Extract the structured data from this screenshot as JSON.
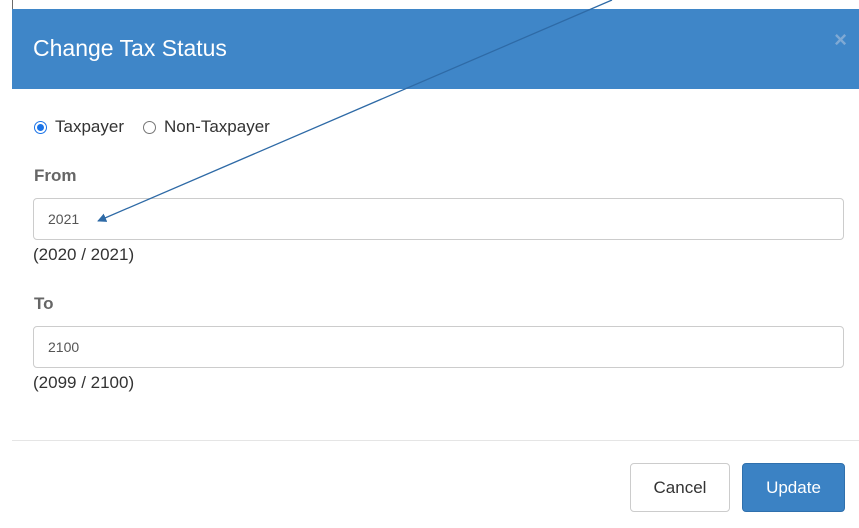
{
  "dialog": {
    "title": "Change Tax Status",
    "close_symbol": "×"
  },
  "tax_status": {
    "options": [
      {
        "label": "Taxpayer",
        "checked": true
      },
      {
        "label": "Non-Taxpayer",
        "checked": false
      }
    ]
  },
  "from": {
    "label": "From",
    "value": "2021",
    "hint": "(2020 / 2021)"
  },
  "to": {
    "label": "To",
    "value": "2100",
    "hint": "(2099 / 2100)"
  },
  "footer": {
    "cancel_label": "Cancel",
    "update_label": "Update"
  },
  "colors": {
    "header": "#3f86c8",
    "primary_button": "#3b82c4",
    "annotation_arrow": "#2e6aa6"
  },
  "icons": {
    "close": "close-icon",
    "annotation": "arrow-annotation"
  }
}
